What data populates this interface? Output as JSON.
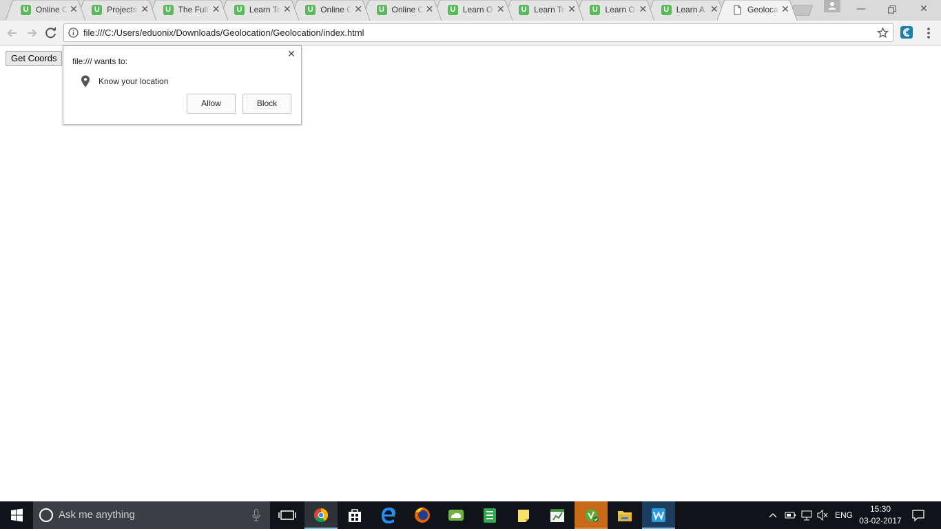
{
  "browser": {
    "tabs": [
      {
        "title": "Online Courses",
        "favicon": "U",
        "active": false
      },
      {
        "title": "Projects",
        "favicon": "U",
        "active": false
      },
      {
        "title": "The Full",
        "favicon": "U",
        "active": false
      },
      {
        "title": "Learn To",
        "favicon": "U",
        "active": false
      },
      {
        "title": "Online C",
        "favicon": "U",
        "active": false
      },
      {
        "title": "Online C",
        "favicon": "U",
        "active": false
      },
      {
        "title": "Learn O",
        "favicon": "U",
        "active": false
      },
      {
        "title": "Learn To",
        "favicon": "U",
        "active": false
      },
      {
        "title": "Learn O",
        "favicon": "U",
        "active": false
      },
      {
        "title": "Learn A",
        "favicon": "U",
        "active": false
      },
      {
        "title": "Geolocation",
        "favicon": "page-icon",
        "active": true
      }
    ],
    "close_glyph": "✕",
    "address_url": "file:///C:/Users/eduonix/Downloads/Geolocation/Geolocation/index.html"
  },
  "page": {
    "get_coords_label": "Get Coords"
  },
  "permission_bubble": {
    "origin_text": "file:/// wants to:",
    "permission_text": "Know your location",
    "allow_label": "Allow",
    "block_label": "Block",
    "close_glyph": "✕"
  },
  "taskbar": {
    "search_placeholder": "Ask me anything",
    "language": "ENG",
    "time": "15:30",
    "date": "03-02-2017"
  }
}
